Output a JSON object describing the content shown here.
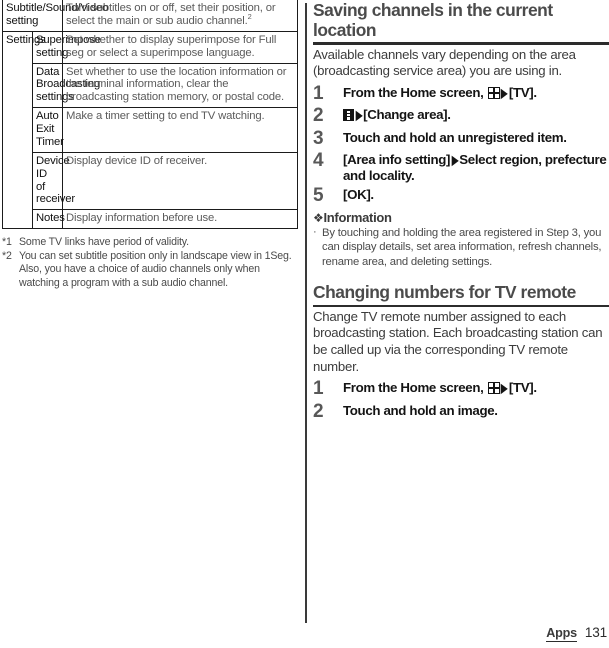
{
  "table": {
    "rows": [
      {
        "col1": "Subtitle/Sound/Video setting",
        "col1_span": 2,
        "col2": "",
        "col3": "Turn subtitles on or off, set their position, or select the main or sub audio channel.",
        "col3_footnote": "2"
      },
      {
        "col1": "Settings",
        "col1_rowspan": 5,
        "col2": "Superimpose setting",
        "col3": "Set whether to display superimpose for Full seg or select a superimpose language.",
        "col3_footnote": ""
      },
      {
        "col1": "",
        "col2": "Data Broadcasting settings",
        "col3": "Set whether to use the location information or the terminal information, clear the broadcasting station memory, or postal code.",
        "col3_footnote": ""
      },
      {
        "col1": "",
        "col2": "Auto Exit Timer",
        "col3": "Make a timer setting to end TV watching.",
        "col3_footnote": ""
      },
      {
        "col1": "",
        "col2": "Device ID of receiver",
        "col3": "Display device ID of receiver.",
        "col3_footnote": ""
      },
      {
        "col1": "",
        "col2": "Notes",
        "col3": "Display information before use.",
        "col3_footnote": ""
      }
    ]
  },
  "footnotes": [
    {
      "mark": "*1",
      "text": "Some TV links have period of validity."
    },
    {
      "mark": "*2",
      "text": "You can set subtitle position only in landscape view in 1Seg. Also, you have a choice of audio channels only when watching a program with a sub audio channel."
    }
  ],
  "sections": [
    {
      "heading": "Saving channels in the current location",
      "intro": "Available channels vary depending on the area (broadcasting service area) you are using in.",
      "steps": [
        {
          "num": "1",
          "pre": "From the Home screen, ",
          "icon": "app-grid-icon",
          "mid": "",
          "post": "[TV]."
        },
        {
          "num": "2",
          "pre": "",
          "icon": "overflow-menu-icon",
          "mid": "",
          "post": "[Change area]."
        },
        {
          "num": "3",
          "pre": "Touch and hold an unregistered item.",
          "icon": "",
          "mid": "",
          "post": ""
        },
        {
          "num": "4",
          "pre": "[Area info setting]",
          "icon": "arrow",
          "mid": "",
          "post": "Select region, prefecture and locality."
        },
        {
          "num": "5",
          "pre": "[OK].",
          "icon": "",
          "mid": "",
          "post": ""
        }
      ],
      "info": {
        "label": "Information",
        "items": [
          "By touching and holding the area registered in Step 3, you can display details, set area information, refresh channels, rename area, and deleting settings."
        ]
      }
    },
    {
      "heading": "Changing numbers for TV remote",
      "intro": "Change TV remote number assigned to each broadcasting station. Each broadcasting station can be called up via the corresponding TV remote number.",
      "steps": [
        {
          "num": "1",
          "pre": "From the Home screen, ",
          "icon": "app-grid-icon",
          "mid": "",
          "post": "[TV]."
        },
        {
          "num": "2",
          "pre": "Touch and hold an image.",
          "icon": "",
          "mid": "",
          "post": ""
        }
      ],
      "info": null
    }
  ],
  "footer": {
    "tab_label": "Apps",
    "page_number": "131"
  },
  "colors": {
    "heading": "#4b4b4b",
    "body_text": "#3c3c3c",
    "step_number": "#585858",
    "table_border": "#1b1b1b",
    "table_desc": "#5b5b5b"
  }
}
